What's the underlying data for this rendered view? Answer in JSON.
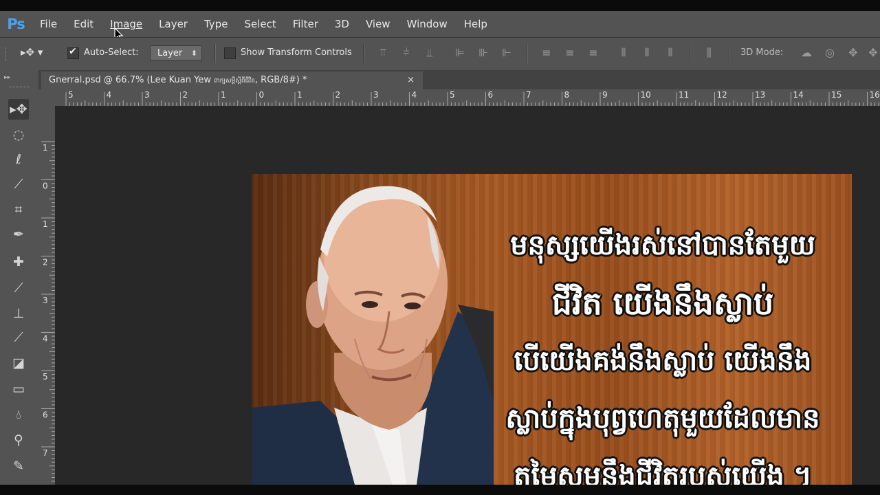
{
  "app": {
    "logo": "Ps"
  },
  "menu": [
    "File",
    "Edit",
    "Image",
    "Layer",
    "Type",
    "Select",
    "Filter",
    "3D",
    "View",
    "Window",
    "Help"
  ],
  "options": {
    "auto_select_label": "Auto-Select:",
    "auto_select_checked": true,
    "layer_dropdown": "Layer",
    "show_transform_label": "Show Transform Controls",
    "show_transform_checked": false,
    "mode_3d_label": "3D Mode:"
  },
  "document": {
    "tab_title": "Gnerral.psd @ 66.7% (Lee Kuan Yew",
    "tab_title_extra": "ពាក្យសម្ដីស្ដីពីជីវិត",
    "tab_title_suffix": ", RGB/8#) *",
    "close_glyph": "×"
  },
  "rulers": {
    "top": [
      "5",
      "4",
      "3",
      "2",
      "1",
      "0",
      "1",
      "2",
      "3",
      "4",
      "5",
      "6",
      "7",
      "8",
      "9",
      "10",
      "11",
      "12",
      "13",
      "14",
      "15",
      "16"
    ],
    "left": [
      "1",
      "0",
      "1",
      "2",
      "3",
      "4",
      "5",
      "6",
      "7",
      "8"
    ]
  },
  "quote_lines": [
    "មនុស្សយើងរស់នៅបានតែមួយ",
    "ជីវិត យើងនឹងស្លាប់",
    "បើយើងគង់នឹងស្លាប់ យើងនឹង",
    "ស្លាប់ក្នុងបុព្វហេតុមួយដែលមាន",
    "តម្លៃសមនឹងជីវិតរបស់យើង ។"
  ],
  "tools": [
    "move-icon",
    "marquee-icon",
    "lasso-icon",
    "quick-select-icon",
    "crop-icon",
    "eyedropper-icon",
    "healing-icon",
    "brush-icon",
    "stamp-icon",
    "history-brush-icon",
    "eraser-icon",
    "gradient-icon",
    "blur-icon",
    "dodge-icon",
    "pen-icon"
  ]
}
